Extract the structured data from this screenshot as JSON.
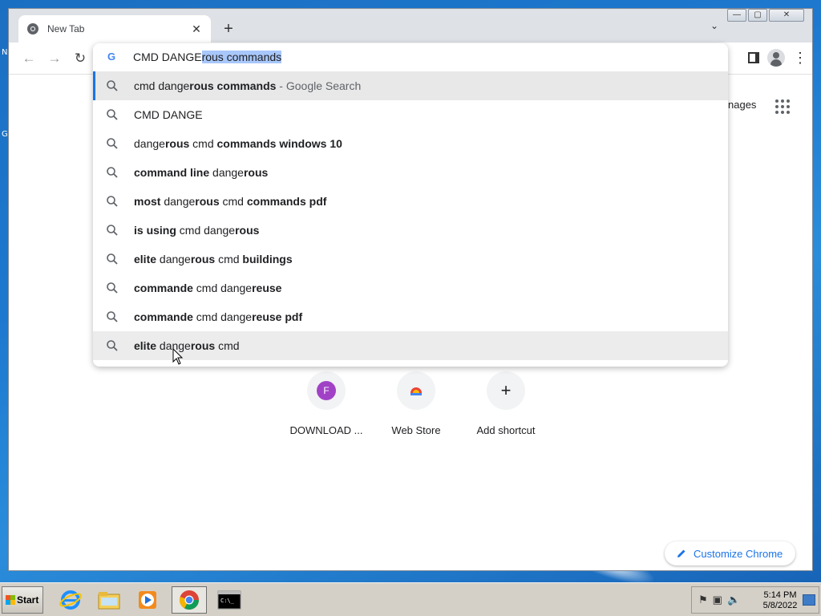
{
  "browser": {
    "tab_title": "New Tab",
    "window_controls": {
      "minimize": "—",
      "maximize": "▢",
      "close": "✕"
    }
  },
  "omnibox": {
    "typed_text": "CMD DANGE",
    "autocomplete_text": "rous commands",
    "suggestions": [
      {
        "parts": [
          [
            "cmd dange",
            false
          ],
          [
            "rous commands",
            true
          ]
        ],
        "suffix": " - Google Search"
      },
      {
        "parts": [
          [
            "CMD DANGE",
            false
          ]
        ],
        "suffix": ""
      },
      {
        "parts": [
          [
            "dange",
            false
          ],
          [
            "rous",
            true
          ],
          [
            " cmd ",
            false
          ],
          [
            "commands windows 10",
            true
          ]
        ],
        "suffix": ""
      },
      {
        "parts": [
          [
            "command line",
            true
          ],
          [
            " dange",
            false
          ],
          [
            "rous",
            true
          ]
        ],
        "suffix": ""
      },
      {
        "parts": [
          [
            "most",
            true
          ],
          [
            " dange",
            false
          ],
          [
            "rous",
            true
          ],
          [
            " cmd ",
            false
          ],
          [
            "commands pdf",
            true
          ]
        ],
        "suffix": ""
      },
      {
        "parts": [
          [
            "is using",
            true
          ],
          [
            " cmd dange",
            false
          ],
          [
            "rous",
            true
          ]
        ],
        "suffix": ""
      },
      {
        "parts": [
          [
            "elite",
            true
          ],
          [
            " dange",
            false
          ],
          [
            "rous",
            true
          ],
          [
            " cmd ",
            false
          ],
          [
            "buildings",
            true
          ]
        ],
        "suffix": ""
      },
      {
        "parts": [
          [
            "commande",
            true
          ],
          [
            " cmd dange",
            false
          ],
          [
            "reuse",
            true
          ]
        ],
        "suffix": ""
      },
      {
        "parts": [
          [
            "commande",
            true
          ],
          [
            " cmd dange",
            false
          ],
          [
            "reuse pdf",
            true
          ]
        ],
        "suffix": ""
      },
      {
        "parts": [
          [
            "elite",
            true
          ],
          [
            " dange",
            false
          ],
          [
            "rous",
            true
          ],
          [
            " cmd",
            false
          ]
        ],
        "suffix": ""
      }
    ]
  },
  "newtab": {
    "images_link": "nages",
    "shortcuts": [
      {
        "label": "DOWNLOAD ...",
        "letter": "F"
      },
      {
        "label": "Web Store"
      },
      {
        "label": "Add shortcut"
      }
    ],
    "customize_label": "Customize Chrome"
  },
  "taskbar": {
    "start_label": "Start",
    "clock_time": "5:14 PM",
    "clock_date": "5/8/2022"
  },
  "desktop": {
    "left_edge_texts": [
      "N",
      "G"
    ]
  },
  "colors": {
    "accent": "#1a73e8",
    "selection": "#a8c7fa",
    "letter_avatar": "#a142c6"
  }
}
